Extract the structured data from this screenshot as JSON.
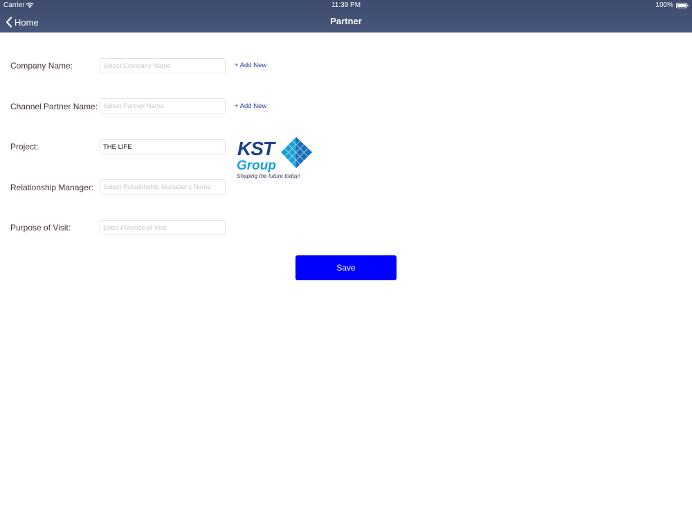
{
  "status_bar": {
    "carrier": "Carrier",
    "time": "11:39 PM",
    "battery": "100%"
  },
  "nav": {
    "back_label": "Home",
    "title": "Partner"
  },
  "form": {
    "company": {
      "label": "Company Name:",
      "placeholder": "Select Company Name",
      "value": "",
      "add_new": "+ Add New"
    },
    "channel_partner": {
      "label": "Channel Partner Name:",
      "placeholder": "Select Partner Name",
      "value": "",
      "add_new": "+ Add New"
    },
    "project": {
      "label": "Project:",
      "placeholder": "",
      "value": "THE LIFE"
    },
    "relationship_manager": {
      "label": "Relationship Manager:",
      "placeholder": "Select Relationship Manager's Name",
      "value": ""
    },
    "purpose": {
      "label": "Purpose of Visit:",
      "placeholder": "Enter Purpose of Visit",
      "value": ""
    }
  },
  "logo": {
    "line1": "KST",
    "line2": "Group",
    "tagline": "Shaping the future today!"
  },
  "save_label": "Save",
  "colors": {
    "nav_bg": "#434f72",
    "save_bg": "#0000ff",
    "link": "#2b3ba8",
    "label": "#43323a",
    "logo_navy": "#1c3f8f",
    "logo_cyan": "#1aa0d8"
  }
}
